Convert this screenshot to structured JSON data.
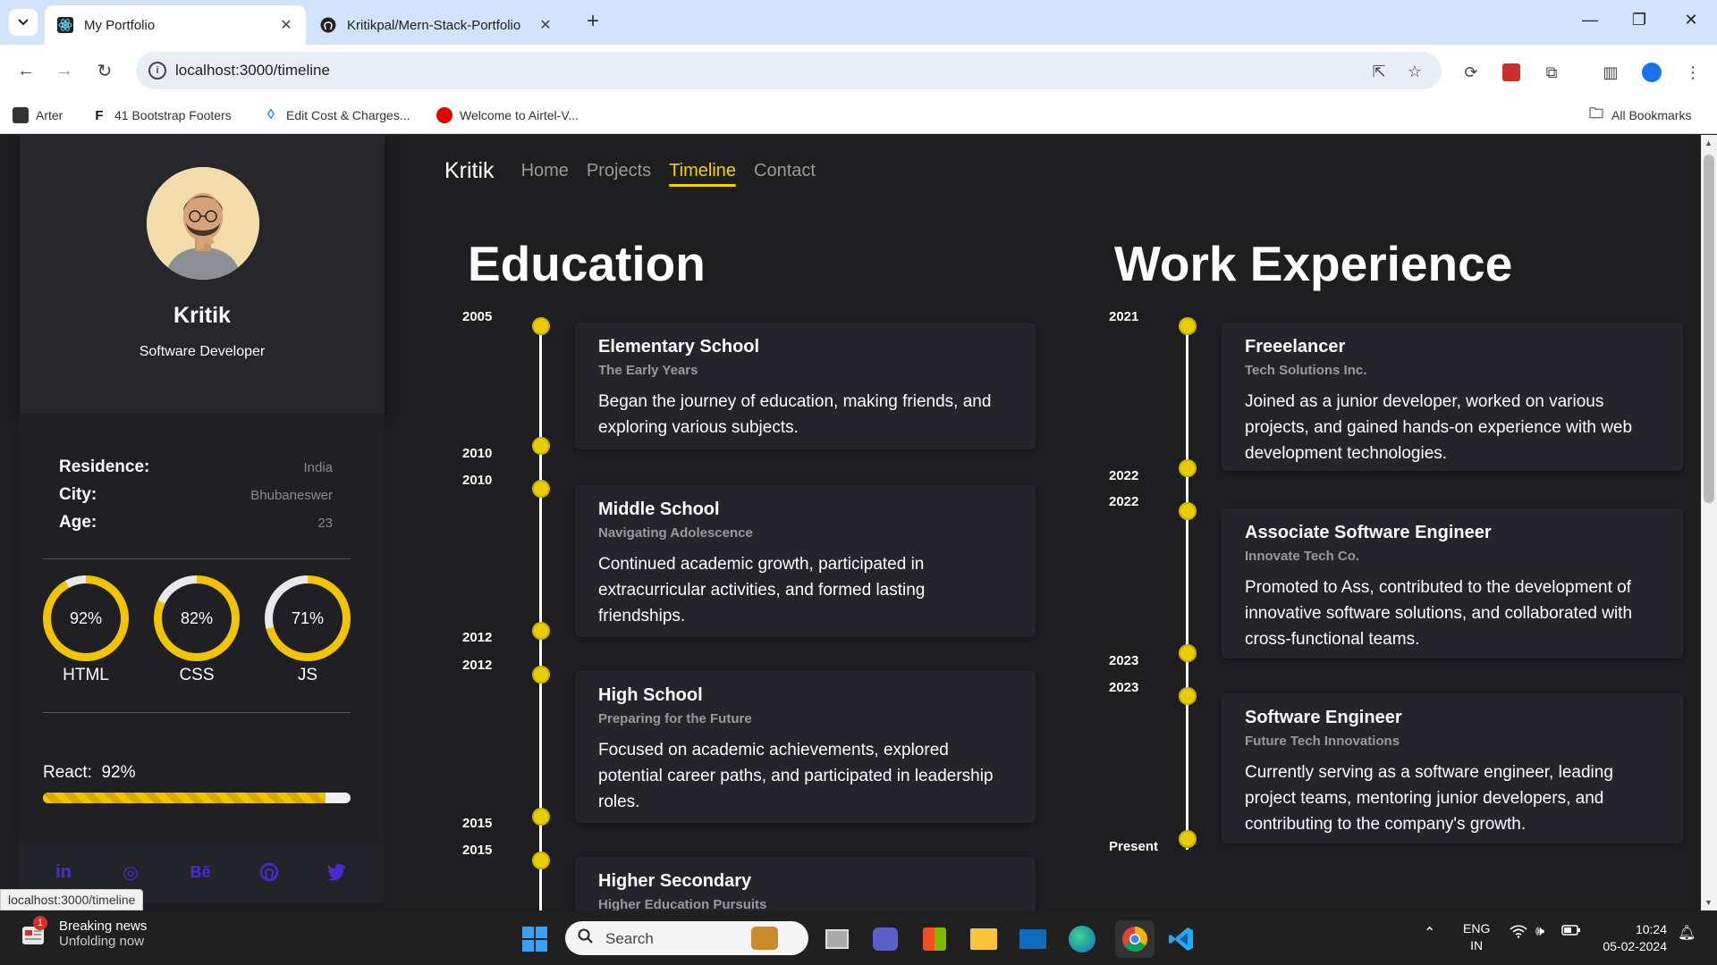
{
  "browser": {
    "tabs": [
      {
        "title": "My Portfolio",
        "active": true
      },
      {
        "title": "Kritikpal/Mern-Stack-Portfolio",
        "active": false
      }
    ],
    "url": "localhost:3000/timeline",
    "bookmarks": [
      "Arter",
      "41 Bootstrap Footers",
      "Edit Cost & Charges...",
      "Welcome to Airtel-V..."
    ],
    "all_bookmarks": "All Bookmarks",
    "status_url": "localhost:3000/timeline"
  },
  "profile": {
    "name": "Kritik",
    "role": "Software Developer",
    "details": [
      {
        "key": "Residence:",
        "value": "India"
      },
      {
        "key": "City:",
        "value": "Bhubaneswer"
      },
      {
        "key": "Age:",
        "value": "23"
      }
    ],
    "skills": [
      {
        "label": "HTML",
        "value": "92%",
        "percent": 92
      },
      {
        "label": "CSS",
        "value": "82%",
        "percent": 82
      },
      {
        "label": "JS",
        "value": "71%",
        "percent": 71
      }
    ],
    "react": {
      "label": "React:",
      "value": "92%",
      "percent": 92
    }
  },
  "nav": {
    "brand": "Kritik",
    "links": [
      "Home",
      "Projects",
      "Timeline",
      "Contact"
    ],
    "active": "Timeline"
  },
  "education": {
    "title": "Education",
    "items": [
      {
        "start": "2005",
        "end": "2010",
        "title": "Elementary School",
        "subtitle": "The Early Years",
        "desc": "Began the journey of education, making friends, and exploring various subjects."
      },
      {
        "start": "2010",
        "end": "2012",
        "title": "Middle School",
        "subtitle": "Navigating Adolescence",
        "desc": "Continued academic growth, participated in extracurricular activities, and formed lasting friendships."
      },
      {
        "start": "2012",
        "end": "2015",
        "title": "High School",
        "subtitle": "Preparing for the Future",
        "desc": "Focused on academic achievements, explored potential career paths, and participated in leadership roles."
      },
      {
        "start": "2015",
        "end": "",
        "title": "Higher Secondary",
        "subtitle": "Higher Education Pursuits",
        "desc": ""
      }
    ]
  },
  "work": {
    "title": "Work Experience",
    "items": [
      {
        "start": "2021",
        "end": "2022",
        "title": "Freeelancer",
        "subtitle": "Tech Solutions Inc.",
        "desc": "Joined as a junior developer, worked on various projects, and gained hands-on experience with web development technologies."
      },
      {
        "start": "2022",
        "end": "2023",
        "title": "Associate Software Engineer",
        "subtitle": "Innovate Tech Co.",
        "desc": "Promoted to Ass, contributed to the development of innovative software solutions, and collaborated with cross-functional teams."
      },
      {
        "start": "2023",
        "end": "Present",
        "title": "Software Engineer",
        "subtitle": "Future Tech Innovations",
        "desc": "Currently serving as a software engineer, leading project teams, mentoring junior developers, and contributing to the company's growth."
      }
    ]
  },
  "taskbar": {
    "news_title": "Breaking news",
    "news_sub": "Unfolding now",
    "news_badge": "1",
    "search": "Search",
    "lang1": "ENG",
    "lang2": "IN",
    "time": "10:24",
    "date": "05-02-2024"
  },
  "colors": {
    "accent": "#f2d200",
    "background": "#1e1e21",
    "social": "#4a2ad6"
  }
}
